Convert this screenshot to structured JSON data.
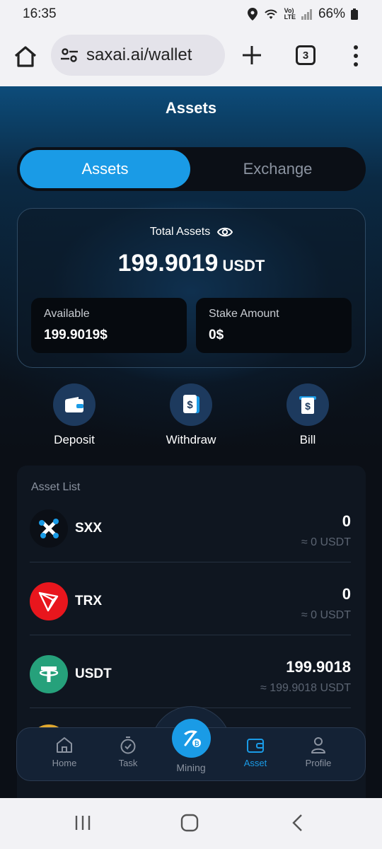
{
  "status_bar": {
    "time": "16:35",
    "battery": "66%"
  },
  "browser": {
    "url": "saxai.ai/wallet",
    "tab_count": "3"
  },
  "page": {
    "title": "Assets"
  },
  "segment": {
    "active": "Assets",
    "inactive": "Exchange"
  },
  "total": {
    "label": "Total Assets",
    "value": "199.9019",
    "unit": "USDT",
    "available_label": "Available",
    "available_value": "199.9019$",
    "stake_label": "Stake Amount",
    "stake_value": "0$"
  },
  "actions": [
    {
      "label": "Deposit",
      "icon": "wallet-icon"
    },
    {
      "label": "Withdraw",
      "icon": "dollar-doc-icon"
    },
    {
      "label": "Bill",
      "icon": "bill-icon"
    }
  ],
  "asset_list": {
    "title": "Asset List",
    "items": [
      {
        "name": "SXX",
        "amount": "0",
        "usdt": "≈ 0 USDT",
        "color": "#0b0f16"
      },
      {
        "name": "TRX",
        "amount": "0",
        "usdt": "≈ 0 USDT",
        "color": "#e8161d"
      },
      {
        "name": "USDT",
        "amount": "199.9018",
        "usdt": "≈ 199.9018 USDT",
        "color": "#26a17b"
      }
    ]
  },
  "nav": {
    "items": [
      "Home",
      "Task",
      "Mining",
      "Asset",
      "Profile"
    ],
    "active": "Asset"
  },
  "colors": {
    "accent": "#1a9be6",
    "background": "#0b0f16"
  }
}
